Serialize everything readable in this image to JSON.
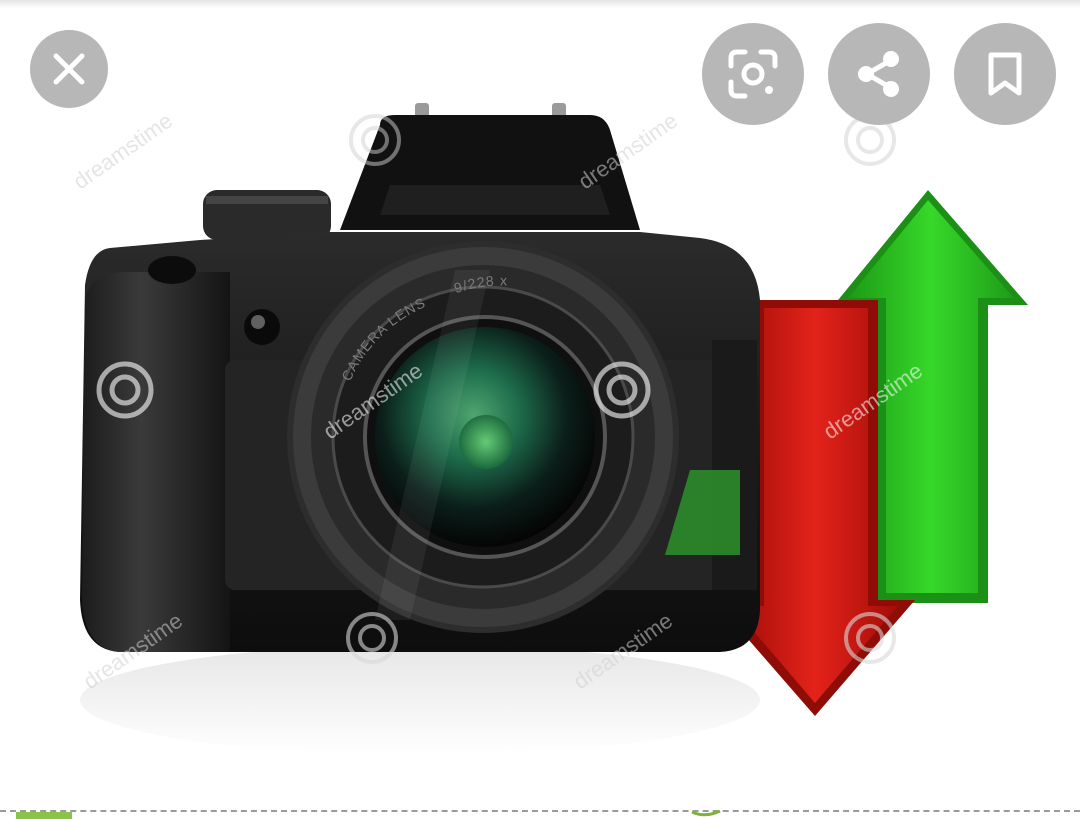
{
  "toolbar": {
    "close_icon": "close-icon",
    "lens_icon": "google-lens-icon",
    "share_icon": "share-icon",
    "bookmark_icon": "bookmark-icon",
    "button_color": "#b7b7b7"
  },
  "image": {
    "watermarks": [
      "dreamstime",
      "dreamstime",
      "dreamstime",
      "dreamstime",
      "dreamstime",
      "dreamstime"
    ],
    "lens_text": "CAMERA LENS",
    "lens_spec": "9/228 x",
    "arrow_down_color": "#d31a12",
    "arrow_up_color": "#2fd31d"
  }
}
